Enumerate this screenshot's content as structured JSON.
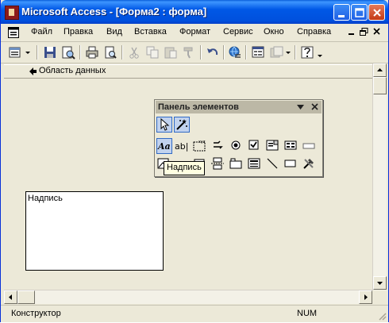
{
  "window": {
    "title": "Microsoft Access - [Форма2 : форма]"
  },
  "menu": {
    "items": [
      {
        "label": "Файл"
      },
      {
        "label": "Правка"
      },
      {
        "label": "Вид"
      },
      {
        "label": "Вставка"
      },
      {
        "label": "Формат"
      },
      {
        "label": "Сервис"
      },
      {
        "label": "Окно"
      },
      {
        "label": "Справка"
      }
    ]
  },
  "form": {
    "section_label": "Область данных",
    "label_control_text": "Надпись"
  },
  "toolbox": {
    "title": "Панель элементов",
    "tooltip": "Надпись"
  },
  "status": {
    "mode": "Конструктор",
    "num": "NUM"
  },
  "colors": {
    "titlebar": "#0058E6",
    "panel": "#ECE9D8",
    "toolbox_header": "#BCB8A6"
  }
}
